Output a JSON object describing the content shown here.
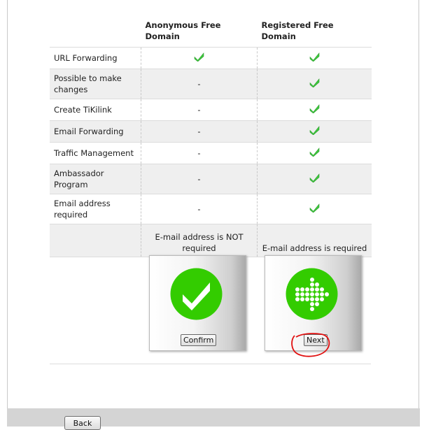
{
  "columns": {
    "anonymous": {
      "header": "Anonymous Free Domain"
    },
    "registered": {
      "header": "Registered Free Domain"
    }
  },
  "features": [
    {
      "label": "URL Forwarding",
      "anonymous": "check",
      "registered": "check"
    },
    {
      "label": "Possible to make changes",
      "anonymous": "-",
      "registered": "check"
    },
    {
      "label": "Create TiKilink",
      "anonymous": "-",
      "registered": "check"
    },
    {
      "label": "Email Forwarding",
      "anonymous": "-",
      "registered": "check"
    },
    {
      "label": "Traffic Management",
      "anonymous": "-",
      "registered": "check"
    },
    {
      "label": "Ambassador Program",
      "anonymous": "-",
      "registered": "check"
    },
    {
      "label": "Email address required",
      "anonymous": "-",
      "registered": "check"
    }
  ],
  "requirement": {
    "anonymous": "E-mail address is NOT required",
    "registered": "E-mail address is required"
  },
  "choices": {
    "confirm_label": "Confirm",
    "next_label": "Next"
  },
  "footer": {
    "back_label": "Back"
  },
  "colors": {
    "check_green": "#3ec83e",
    "icon_green": "#33cc00",
    "annotation_red": "#e01010"
  },
  "icons": {
    "feature_available": "checkmark-icon",
    "confirm": "big-checkmark-icon",
    "next": "dotted-arrow-icon"
  }
}
